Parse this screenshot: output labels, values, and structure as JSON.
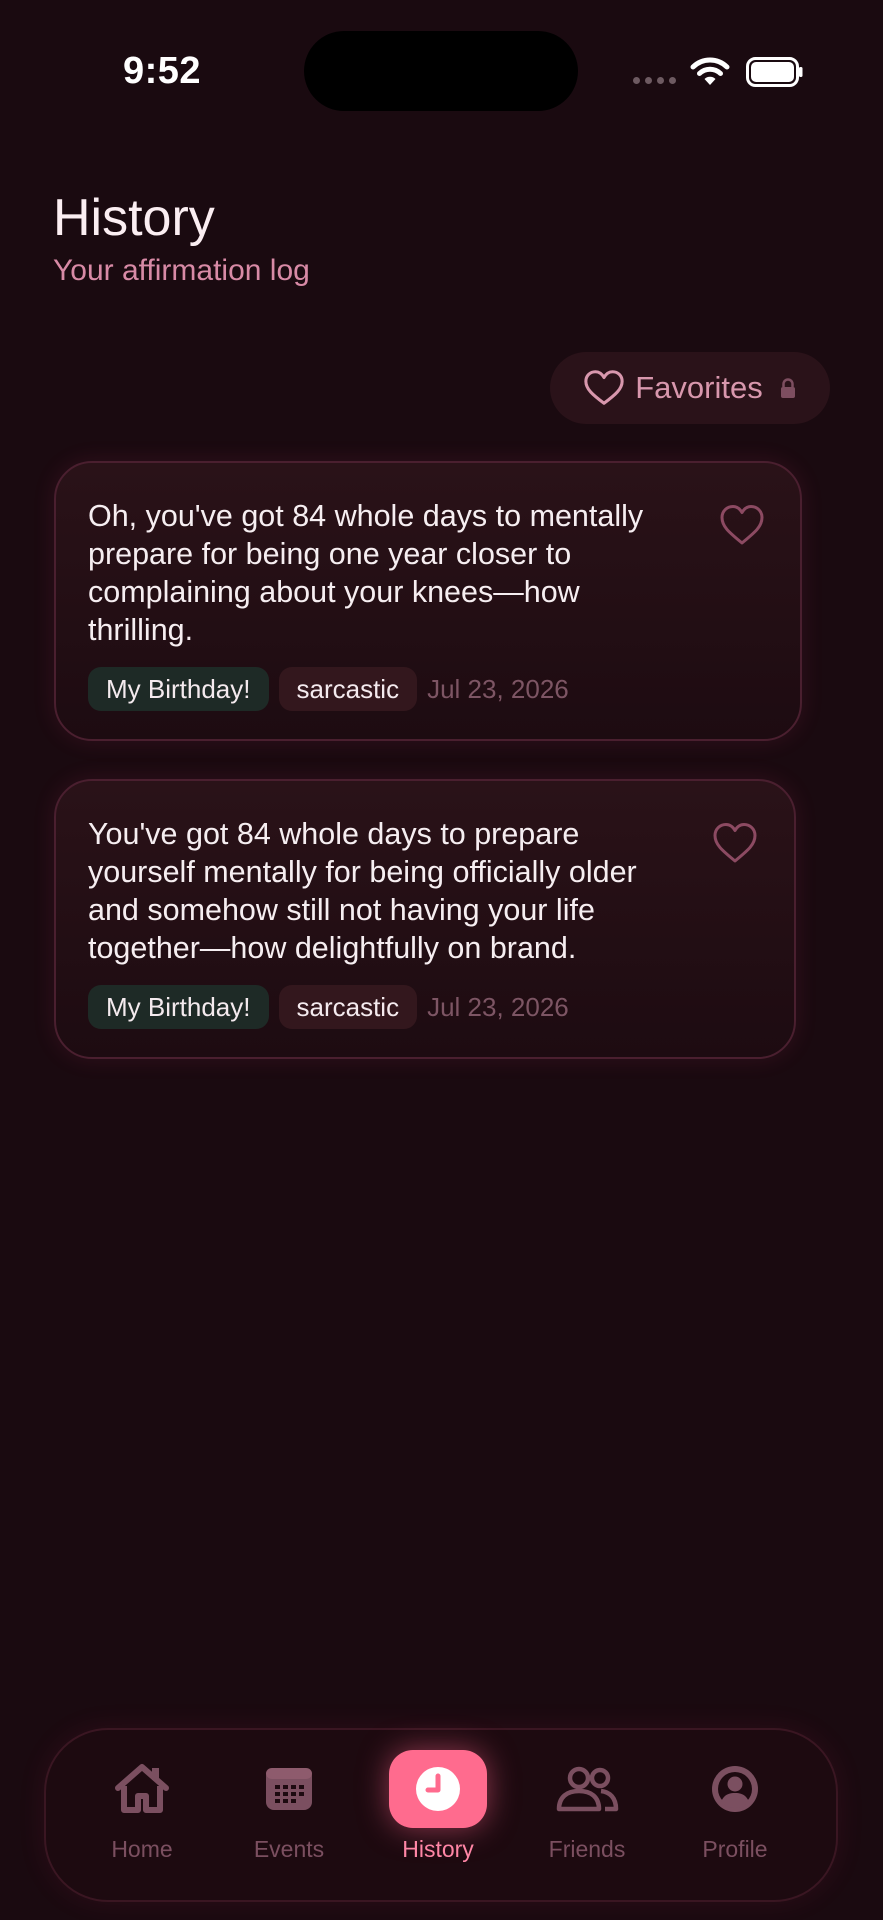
{
  "status": {
    "time": "9:52"
  },
  "header": {
    "title": "History",
    "subtitle": "Your affirmation log"
  },
  "favorites": {
    "label": "Favorites",
    "icon": "heart-outline-icon",
    "lock_icon": "lock-icon"
  },
  "history": [
    {
      "text": "Oh, you've got 84 whole days to mentally prepare for being one year closer to complaining about your knees—how thrilling.",
      "event": "My Birthday!",
      "tone": "sarcastic",
      "date": "Jul 23, 2026"
    },
    {
      "text": "You've got 84 whole days to prepare yourself mentally for being officially older and somehow still not having your life together—how delightfully on brand.",
      "event": "My Birthday!",
      "tone": "sarcastic",
      "date": "Jul 23, 2026"
    }
  ],
  "tabs": [
    {
      "label": "Home",
      "icon": "home-icon"
    },
    {
      "label": "Events",
      "icon": "calendar-icon"
    },
    {
      "label": "History",
      "icon": "clock-icon",
      "active": true
    },
    {
      "label": "Friends",
      "icon": "people-icon"
    },
    {
      "label": "Profile",
      "icon": "person-circle-icon"
    }
  ],
  "colors": {
    "background": "#1a0a10",
    "accent": "#ff6b8e",
    "subtitle": "#d88aa6",
    "event_chip": "#1e2a26",
    "tone_chip": "#33171d"
  }
}
